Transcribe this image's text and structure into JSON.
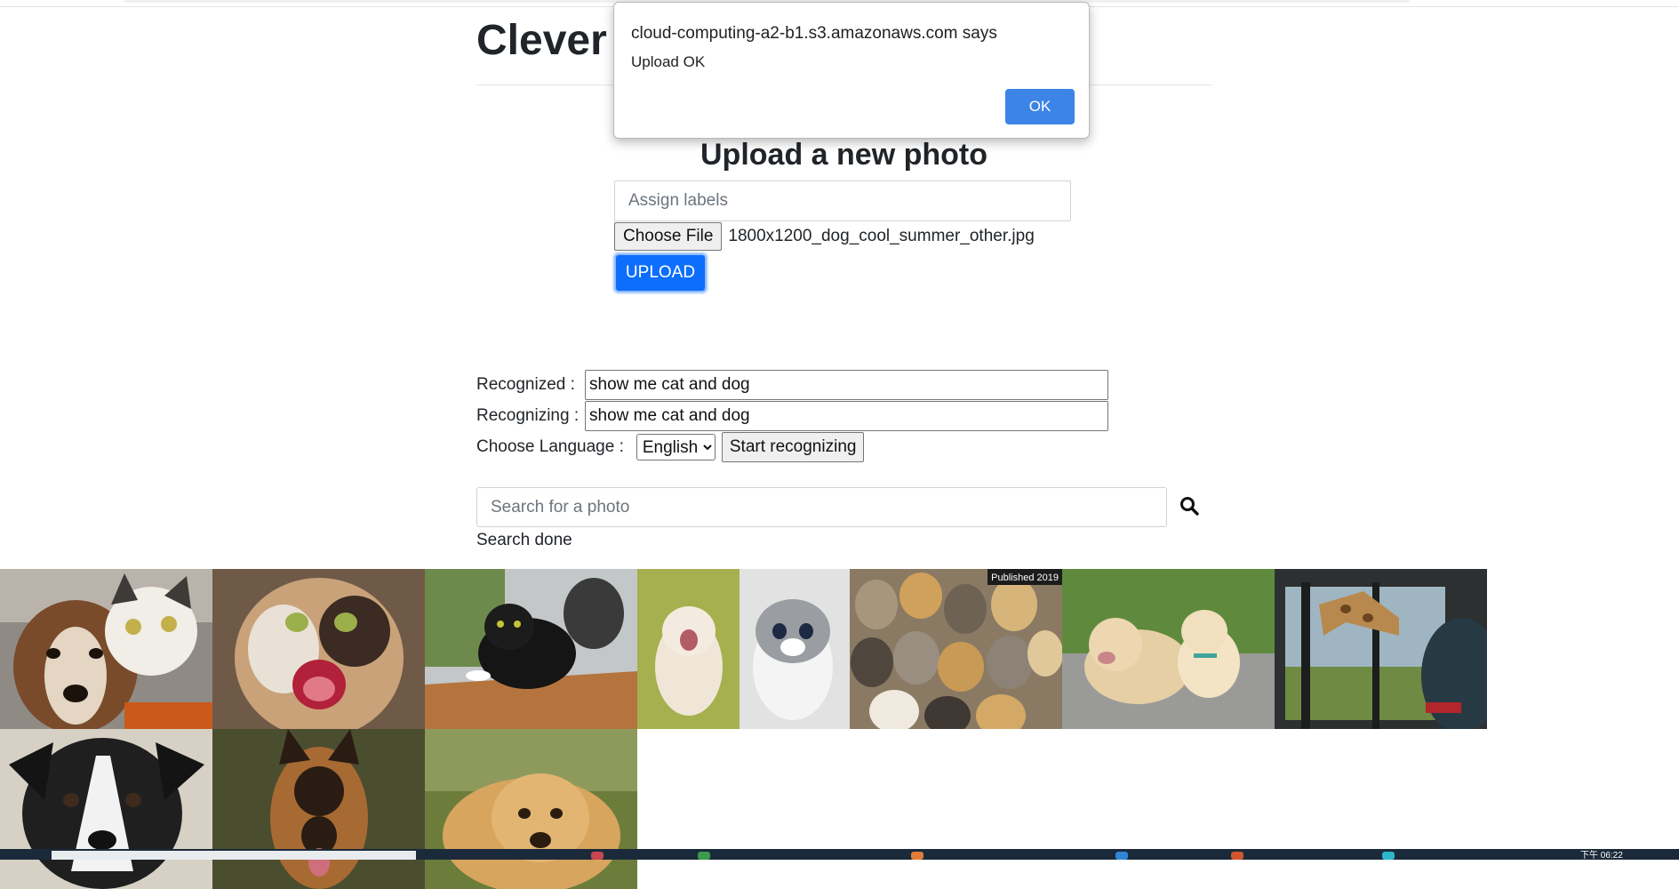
{
  "app": {
    "title": "Clever P"
  },
  "upload": {
    "heading": "Upload a new photo",
    "labels_placeholder": "Assign labels",
    "choose_file_label": "Choose File",
    "file_name": "1800x1200_dog_cool_summer_other.jpg",
    "upload_label": "UPLOAD"
  },
  "speech": {
    "recognized_label": "Recognized :",
    "recognized_value": "show me cat and dog",
    "recognizing_label": "Recognizing :",
    "recognizing_value": "show me cat and dog",
    "language_label": "Choose Language :",
    "language_selected": "English",
    "start_label": "Start recognizing"
  },
  "search": {
    "placeholder": "Search for a photo",
    "status": "Search done",
    "icon": "search-icon"
  },
  "gallery": {
    "photos": [
      {
        "subject": "dog and cat",
        "badge": ""
      },
      {
        "subject": "hissing calico cat",
        "badge": ""
      },
      {
        "subject": "black cat on table",
        "badge": ""
      },
      {
        "subject": "two kittens",
        "badge": ""
      },
      {
        "subject": "group of cats",
        "badge": "Published 2019"
      },
      {
        "subject": "two puppies",
        "badge": ""
      },
      {
        "subject": "giraffe at window",
        "badge": ""
      },
      {
        "subject": "black and white puppy",
        "badge": ""
      },
      {
        "subject": "german shepherd",
        "badge": ""
      },
      {
        "subject": "golden retriever puppy",
        "badge": ""
      }
    ]
  },
  "dialog": {
    "origin": "cloud-computing-a2-b1.s3.amazonaws.com says",
    "message": "Upload OK",
    "ok_label": "OK"
  },
  "taskbar": {
    "clock": "下午 06:22"
  },
  "colors": {
    "primary": "#0d6efd",
    "dialog_ok": "#3c84e6"
  }
}
